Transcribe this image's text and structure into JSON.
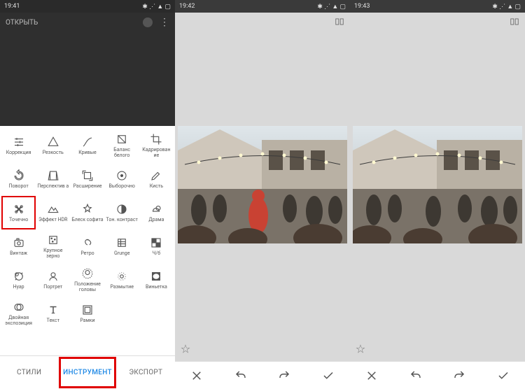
{
  "status": {
    "time1": "19:41",
    "time2": "19:42",
    "time3": "19:43"
  },
  "topbar": {
    "open": "ОТКРЫТЬ"
  },
  "tools": [
    {
      "id": "tune",
      "label": "Коррекция"
    },
    {
      "id": "details",
      "label": "Резкость"
    },
    {
      "id": "curves",
      "label": "Кривые"
    },
    {
      "id": "whitebalance",
      "label": "Баланс белого"
    },
    {
      "id": "crop",
      "label": "Кадрирован ие"
    },
    {
      "id": "rotate",
      "label": "Поворот"
    },
    {
      "id": "perspective",
      "label": "Перспектив а"
    },
    {
      "id": "expand",
      "label": "Расширение"
    },
    {
      "id": "selective",
      "label": "Выборочно"
    },
    {
      "id": "brush",
      "label": "Кисть"
    },
    {
      "id": "healing",
      "label": "Точечно",
      "highlight": true
    },
    {
      "id": "hdr",
      "label": "Эффект HDR"
    },
    {
      "id": "glamour",
      "label": "Блеск софита"
    },
    {
      "id": "tonal",
      "label": "Тон. контраст"
    },
    {
      "id": "drama",
      "label": "Драма"
    },
    {
      "id": "vintage",
      "label": "Винтаж"
    },
    {
      "id": "grainy",
      "label": "Крупное зерно"
    },
    {
      "id": "retrolux",
      "label": "Ретро"
    },
    {
      "id": "grunge",
      "label": "Grunge"
    },
    {
      "id": "bw",
      "label": "Ч/б"
    },
    {
      "id": "noir",
      "label": "Нуар"
    },
    {
      "id": "portrait",
      "label": "Портрет"
    },
    {
      "id": "headpose",
      "label": "Положение головы"
    },
    {
      "id": "lensblur",
      "label": "Размытие"
    },
    {
      "id": "vignette",
      "label": "Виньетка"
    },
    {
      "id": "double",
      "label": "Двойная экспозиция"
    },
    {
      "id": "text",
      "label": "Текст"
    },
    {
      "id": "frames",
      "label": "Рамки"
    }
  ],
  "tabs": {
    "styles": "СТИЛИ",
    "tools": "ИНСТРУМЕНТ",
    "export": "ЭКСПОРТ"
  }
}
